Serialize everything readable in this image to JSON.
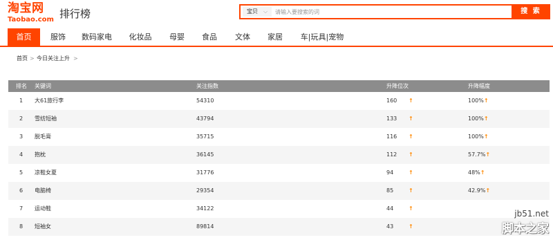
{
  "header": {
    "logo_main": "淘宝网",
    "logo_sub": "Taobao.com",
    "page_name": "排行榜"
  },
  "search": {
    "scope": "宝贝",
    "placeholder": "请输入要搜索的词",
    "button": "搜 索"
  },
  "nav": {
    "items": [
      "首页",
      "服饰",
      "数码家电",
      "化妆品",
      "母婴",
      "食品",
      "文体",
      "家居",
      "车|玩具|宠物"
    ],
    "active_index": 0
  },
  "breadcrumb": {
    "home": "首页",
    "separator": ">",
    "current": "今日关注上升"
  },
  "table": {
    "headers": [
      "排名",
      "关键词",
      "关注指数",
      "升降位次",
      "升降幅度"
    ],
    "rows": [
      {
        "rank": "1",
        "keyword": "大61旅行李",
        "index": "54310",
        "position_change": "160",
        "change_pct": "100%"
      },
      {
        "rank": "2",
        "keyword": "雪纺短袖",
        "index": "43794",
        "position_change": "133",
        "change_pct": "100%"
      },
      {
        "rank": "3",
        "keyword": "脱毛膏",
        "index": "35715",
        "position_change": "116",
        "change_pct": "100%"
      },
      {
        "rank": "4",
        "keyword": "抱枕",
        "index": "36145",
        "position_change": "112",
        "change_pct": "57.7%"
      },
      {
        "rank": "5",
        "keyword": "凉鞋女夏",
        "index": "31776",
        "position_change": "94",
        "change_pct": "48%"
      },
      {
        "rank": "6",
        "keyword": "电脑椅",
        "index": "29354",
        "position_change": "85",
        "change_pct": "42.9%"
      },
      {
        "rank": "7",
        "keyword": "运动鞋",
        "index": "34122",
        "position_change": "44",
        "change_pct": ""
      },
      {
        "rank": "8",
        "keyword": "短袖女",
        "index": "89814",
        "position_change": "43",
        "change_pct": ""
      }
    ],
    "arrow_symbol": "↑"
  },
  "watermark": {
    "site": "jb51.net",
    "name": "脚本之家"
  },
  "colors": {
    "accent": "#ff4400",
    "header_bg": "#8c8c8c",
    "arrow": "#ff8800",
    "alt_row": "#f5f5f5"
  }
}
